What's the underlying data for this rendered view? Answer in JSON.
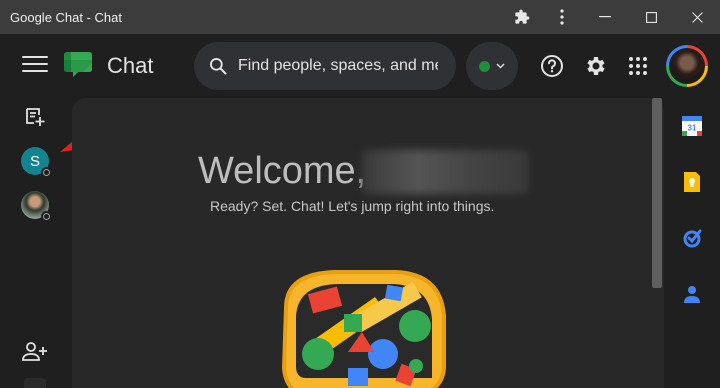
{
  "window": {
    "title": "Google Chat - Chat",
    "extensions_icon": "puzzle-icon",
    "menu_icon": "kebab-icon",
    "minimize_icon": "minimize-icon",
    "maximize_icon": "maximize-icon",
    "close_icon": "close-icon"
  },
  "header": {
    "app_name": "Chat",
    "search_placeholder": "Find people, spaces, and messages",
    "status_color": "#1e8e3e",
    "help_icon": "help-icon",
    "settings_icon": "gear-icon",
    "apps_icon": "apps-grid-icon"
  },
  "left_rail": {
    "avatar_initial": "S"
  },
  "welcome": {
    "greeting": "Welcome,",
    "subtitle": "Ready? Set. Chat! Let's jump right into things."
  },
  "side_apps": [
    "calendar-icon",
    "keep-icon",
    "tasks-icon",
    "contacts-icon"
  ],
  "colors": {
    "calendar_blue": "#4285f4",
    "keep_yellow": "#fbbc04",
    "tasks_blue": "#4285f4",
    "contacts_blue": "#4285f4",
    "annotation_arrow": "#e02020"
  }
}
